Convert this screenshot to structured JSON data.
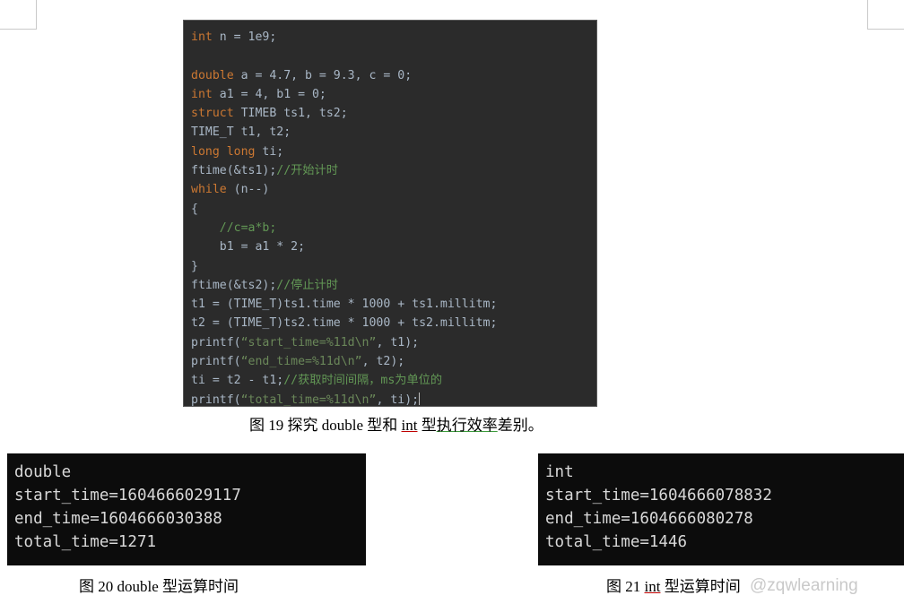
{
  "code_block": {
    "lines": [
      [
        {
          "t": "int",
          "c": "kw"
        },
        {
          "t": " n = 1e9;",
          "c": "plain"
        }
      ],
      [],
      [
        {
          "t": "double",
          "c": "kw"
        },
        {
          "t": " a = 4.7, b = 9.3, c = 0;",
          "c": "plain"
        }
      ],
      [
        {
          "t": "int",
          "c": "kw"
        },
        {
          "t": " a1 = 4, b1 = 0;",
          "c": "plain"
        }
      ],
      [
        {
          "t": "struct",
          "c": "kw"
        },
        {
          "t": " TIMEB ts1, ts2;",
          "c": "plain"
        }
      ],
      [
        {
          "t": "TIME_T t1, t2;",
          "c": "plain"
        }
      ],
      [
        {
          "t": "long long",
          "c": "kw"
        },
        {
          "t": " ti;",
          "c": "plain"
        }
      ],
      [
        {
          "t": "ftime(&ts1);",
          "c": "plain"
        },
        {
          "t": "//开始计时",
          "c": "cmt"
        }
      ],
      [
        {
          "t": "while",
          "c": "kw"
        },
        {
          "t": " (n--)",
          "c": "plain"
        }
      ],
      [
        {
          "t": "{",
          "c": "plain"
        }
      ],
      [
        {
          "t": "    //c=a*b;",
          "c": "cmt"
        }
      ],
      [
        {
          "t": "    b1 = a1 * 2;",
          "c": "plain"
        }
      ],
      [
        {
          "t": "}",
          "c": "plain"
        }
      ],
      [
        {
          "t": "ftime(&ts2);",
          "c": "plain"
        },
        {
          "t": "//停止计时",
          "c": "cmt"
        }
      ],
      [
        {
          "t": "t1 = (TIME_T)ts1.time * 1000 + ts1.millitm;",
          "c": "plain"
        }
      ],
      [
        {
          "t": "t2 = (TIME_T)ts2.time * 1000 + ts2.millitm;",
          "c": "plain"
        }
      ],
      [
        {
          "t": "printf(",
          "c": "plain"
        },
        {
          "t": "“start_time=%11d\\n”",
          "c": "str"
        },
        {
          "t": ", t1);",
          "c": "plain"
        }
      ],
      [
        {
          "t": "printf(",
          "c": "plain"
        },
        {
          "t": "“end_time=%11d\\n”",
          "c": "str"
        },
        {
          "t": ", t2);",
          "c": "plain"
        }
      ],
      [
        {
          "t": "ti = t2 - t1;",
          "c": "plain"
        },
        {
          "t": "//获取时间间隔，ms为单位的",
          "c": "cmt"
        }
      ],
      [
        {
          "t": "printf(",
          "c": "plain"
        },
        {
          "t": "“total_time=%11d\\n”",
          "c": "str"
        },
        {
          "t": ", ti);",
          "c": "plain"
        }
      ]
    ]
  },
  "captions": {
    "fig19_pre": "图 19  探究 double 型和 ",
    "fig19_red": "int",
    "fig19_mid": " 型",
    "fig19_green": "执行效率",
    "fig19_post": "差别。",
    "fig20": "图 20 double 型运算时间",
    "fig21_pre": "图 21 ",
    "fig21_red": "int",
    "fig21_post": " 型运算时间"
  },
  "console_left": {
    "lines": [
      "double",
      "start_time=1604666029117",
      "end_time=1604666030388",
      "total_time=1271"
    ]
  },
  "console_right": {
    "lines": [
      "int",
      "start_time=1604666078832",
      "end_time=1604666080278",
      "total_time=1446"
    ]
  },
  "watermark": {
    "text": "@zqwlearning"
  }
}
